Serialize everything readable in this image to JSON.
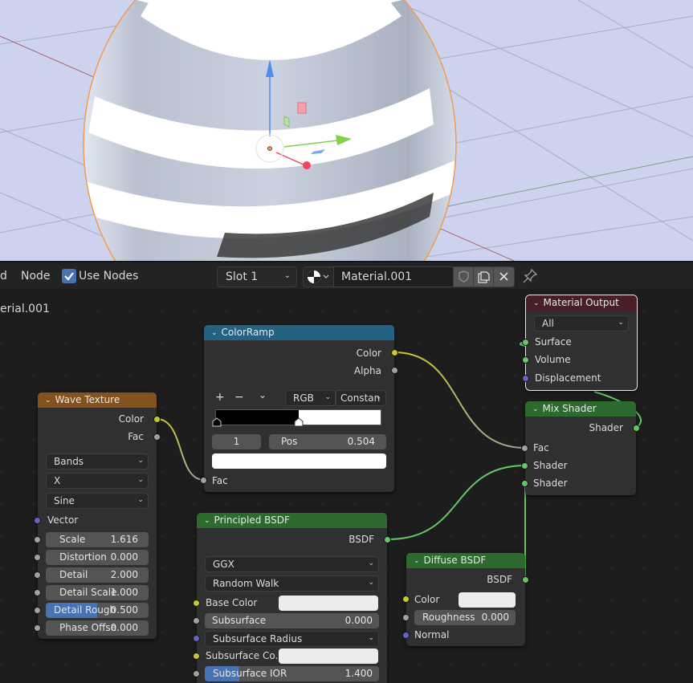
{
  "viewport": {
    "background": "#cdd3ef",
    "object": "sphere",
    "selection_outline": "#f39c4f",
    "gizmo_axes": {
      "x": "#f0455d",
      "y": "#7fd24a",
      "z": "#4e8df0"
    }
  },
  "header": {
    "menu_partial": "d",
    "menu_node": "Node",
    "use_nodes_label": "Use Nodes",
    "use_nodes_checked": true,
    "slot": "Slot 1",
    "material_name": "Material.001",
    "icons": [
      "material-sphere-icon",
      "fake-user-shield-icon",
      "duplicate-icon",
      "unlink-x-icon",
      "pin-icon"
    ]
  },
  "breadcrumb": "erial.001",
  "nodes": {
    "wave_texture": {
      "title": "Wave Texture",
      "header_color": "#83521f",
      "outputs": [
        "Color",
        "Fac"
      ],
      "dropdowns": [
        "Bands",
        "X",
        "Sine"
      ],
      "vector_label": "Vector",
      "fields": [
        {
          "label": "Scale",
          "value": "1.616",
          "fill": 0
        },
        {
          "label": "Distortion",
          "value": "0.000",
          "fill": 0
        },
        {
          "label": "Detail",
          "value": "2.000",
          "fill": 0
        },
        {
          "label": "Detail Scale",
          "value": "1.000",
          "fill": 0
        },
        {
          "label": "Detail Rough",
          "value": "0.500",
          "fill": 0.5
        },
        {
          "label": "Phase Offse",
          "value": "0.000",
          "fill": 0
        }
      ]
    },
    "color_ramp": {
      "title": "ColorRamp",
      "header_color": "#246283",
      "outputs": [
        "Color",
        "Alpha"
      ],
      "tools": {
        "add": "+",
        "remove": "−",
        "menu": "⌄"
      },
      "color_mode": "RGB",
      "interpolation": "Constan",
      "stop_index": "1",
      "pos_label": "Pos",
      "pos_value": "0.504",
      "stop_position": 0.504,
      "stop_color": "#ffffff",
      "input": "Fac"
    },
    "principled_bsdf": {
      "title": "Principled BSDF",
      "header_color": "#2d6a2d",
      "output": "BSDF",
      "distribution": "GGX",
      "subsurface_method": "Random Walk",
      "inputs": {
        "base_color": "Base Color",
        "subsurface": {
          "label": "Subsurface",
          "value": "0.000"
        },
        "subsurface_radius": "Subsurface Radius",
        "subsurface_color": "Subsurface Co...",
        "subsurface_ior": {
          "label": "Subsurface IOR",
          "value": "1.400",
          "fill": 0.2
        }
      }
    },
    "diffuse_bsdf": {
      "title": "Diffuse BSDF",
      "header_color": "#2d6a2d",
      "output": "BSDF",
      "color_label": "Color",
      "roughness": {
        "label": "Roughness",
        "value": "0.000"
      },
      "normal_label": "Normal"
    },
    "material_output": {
      "title": "Material Output",
      "header_color": "#4a1e27",
      "target": "All",
      "inputs": [
        "Surface",
        "Volume",
        "Displacement"
      ]
    },
    "mix_shader": {
      "title": "Mix Shader",
      "header_color": "#2d6a2d",
      "output": "Shader",
      "inputs": [
        "Fac",
        "Shader",
        "Shader"
      ]
    }
  },
  "links": [
    {
      "from": "wave_texture.Color",
      "to": "color_ramp.Fac",
      "color": "yellow-to-gray"
    },
    {
      "from": "color_ramp.Color",
      "to": "mix_shader.Fac",
      "color": "yellow-to-gray"
    },
    {
      "from": "principled_bsdf.BSDF",
      "to": "mix_shader.Shader1",
      "color": "green"
    },
    {
      "from": "diffuse_bsdf.BSDF",
      "to": "mix_shader.Shader2",
      "color": "green"
    },
    {
      "from": "mix_shader.Shader",
      "to": "material_output.Surface",
      "color": "green"
    }
  ]
}
